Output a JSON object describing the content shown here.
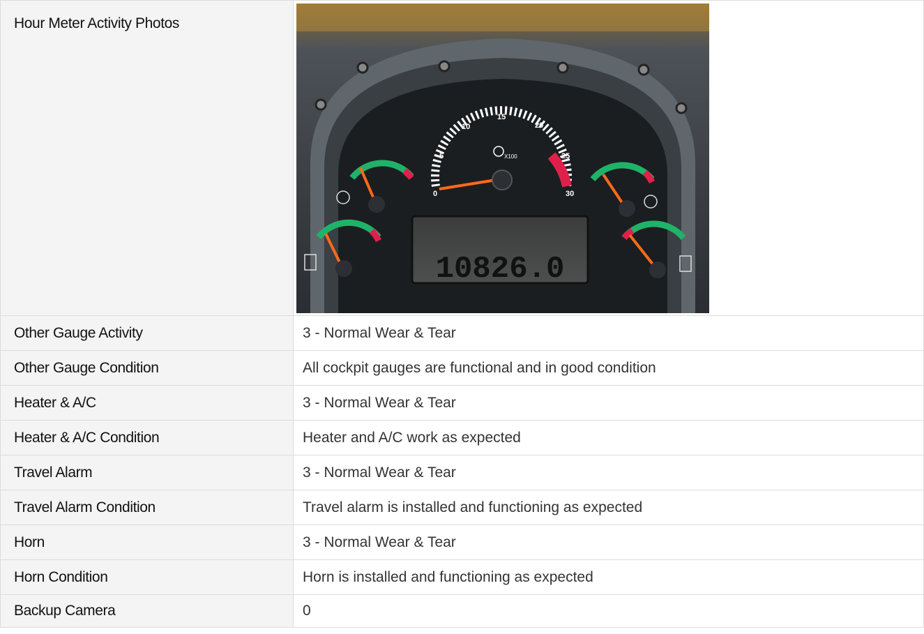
{
  "photo_section": {
    "label": "Hour Meter Activity Photos",
    "dashboard": {
      "tach_labels": [
        "0",
        "5",
        "10",
        "15",
        "20",
        "25",
        "30"
      ],
      "tach_unit": "X100",
      "hour_reading": "10826.0"
    }
  },
  "rows": [
    {
      "label": "Other Gauge Activity",
      "value": "3 - Normal Wear & Tear"
    },
    {
      "label": "Other Gauge Condition",
      "value": "All cockpit gauges are functional and in good condition"
    },
    {
      "label": "Heater & A/C",
      "value": "3 - Normal Wear & Tear"
    },
    {
      "label": "Heater & A/C Condition",
      "value": "Heater and A/C work as expected"
    },
    {
      "label": "Travel Alarm",
      "value": "3 - Normal Wear & Tear"
    },
    {
      "label": "Travel Alarm Condition",
      "value": "Travel alarm is installed and functioning as expected"
    },
    {
      "label": "Horn",
      "value": "3 - Normal Wear & Tear"
    },
    {
      "label": "Horn Condition",
      "value": "Horn is installed and functioning as expected"
    },
    {
      "label": "Backup Camera",
      "value": "0"
    }
  ]
}
